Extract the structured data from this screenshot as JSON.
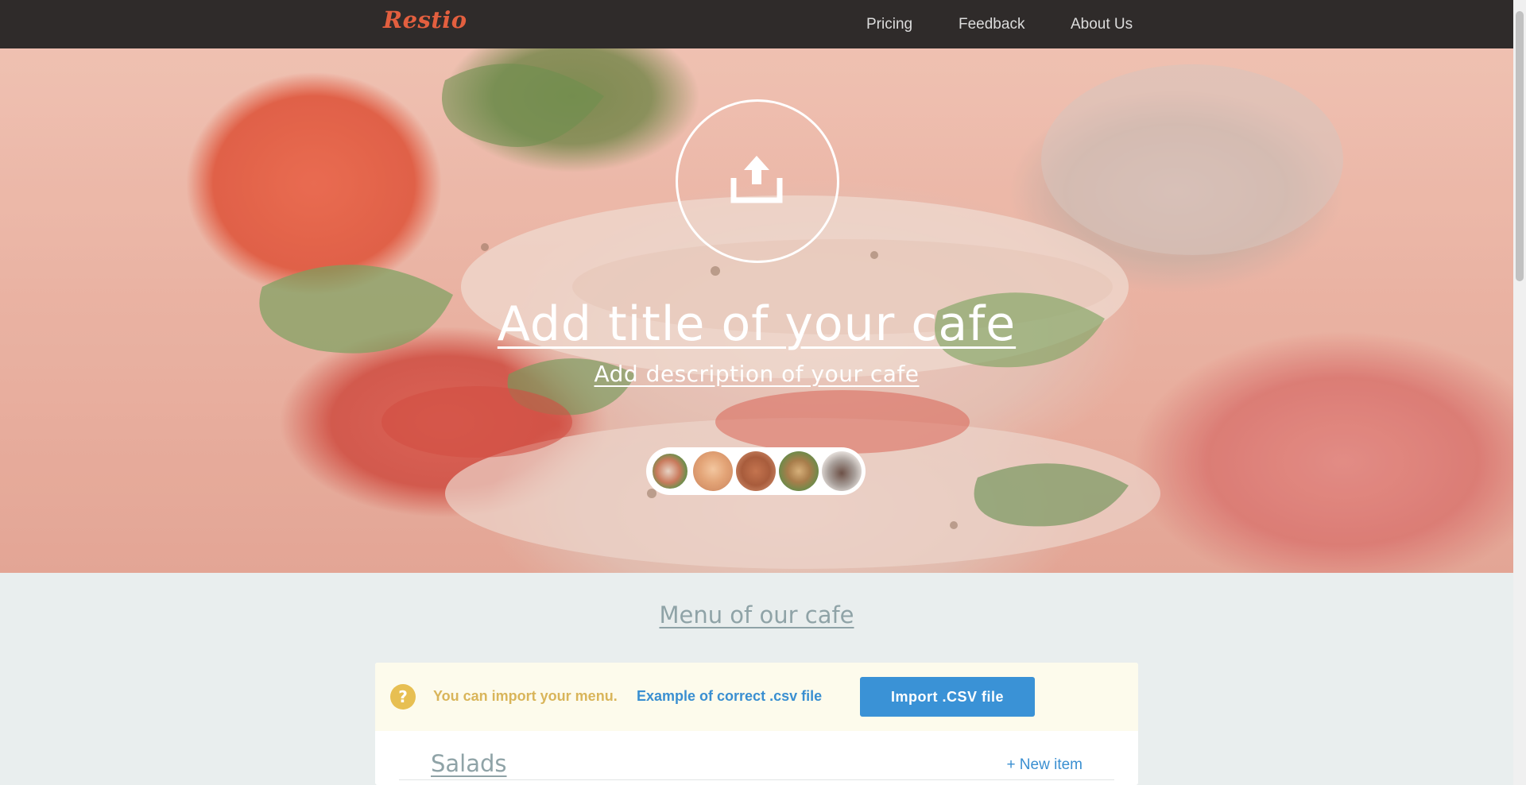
{
  "header": {
    "logo": "Restio",
    "nav": {
      "pricing": "Pricing",
      "feedback": "Feedback",
      "about": "About Us"
    }
  },
  "hero": {
    "upload_icon": "upload-icon",
    "title": "Add title of your cafe",
    "description": "Add description of your cafe",
    "thumbnails": [
      "wrap-thumbnail",
      "pastry-thumbnail",
      "meat-dish-thumbnail",
      "salad-bowl-thumbnail",
      "coffee-cup-thumbnail"
    ]
  },
  "menu": {
    "heading": "Menu of our cafe",
    "import_notice": {
      "icon": "question-icon",
      "text": "You can import your menu.",
      "link": "Example of correct .csv file",
      "button": "Import .CSV file"
    },
    "category": "Salads",
    "new_item": "+ New item"
  },
  "colors": {
    "topbar": "#2f2b2a",
    "logo": "#e35f3f",
    "accent_blue": "#3a92d6",
    "notice_bg": "#fdfbec",
    "notice_text": "#d9b55a",
    "muted_heading": "#8fa3a7"
  }
}
